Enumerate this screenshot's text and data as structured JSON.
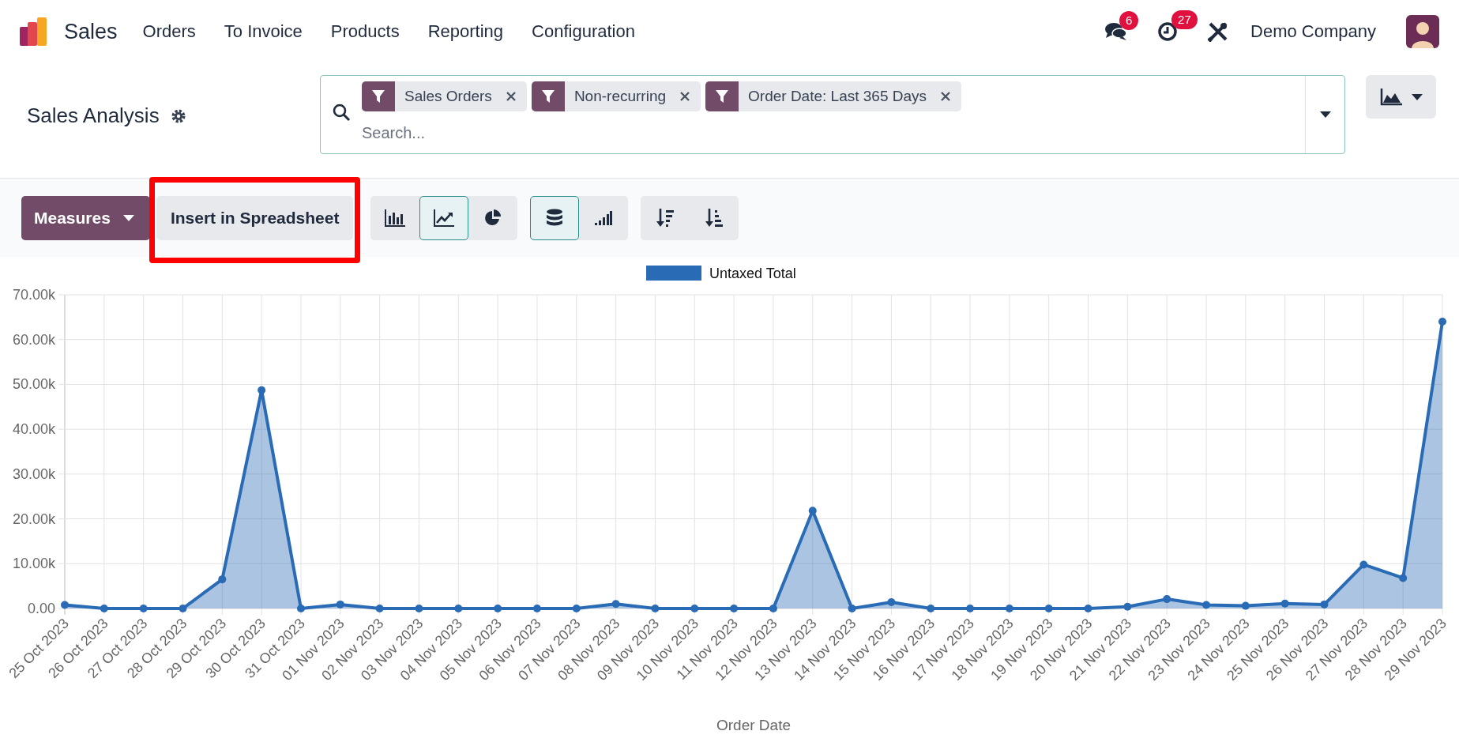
{
  "app": {
    "name": "Sales"
  },
  "menu": [
    {
      "label": "Orders"
    },
    {
      "label": "To Invoice"
    },
    {
      "label": "Products"
    },
    {
      "label": "Reporting"
    },
    {
      "label": "Configuration"
    }
  ],
  "systray": {
    "messages_count": "6",
    "activities_count": "27",
    "company": "Demo Company"
  },
  "breadcrumb": {
    "title": "Sales Analysis"
  },
  "search": {
    "facets": [
      {
        "label": "Sales Orders"
      },
      {
        "label": "Non-recurring"
      },
      {
        "label": "Order Date: Last 365 Days"
      }
    ],
    "placeholder": "Search..."
  },
  "toolbar": {
    "measures": "Measures",
    "insert": {
      "label": "Insert in Spreadsheet",
      "highlighted": true
    },
    "chart_types": [
      {
        "kind": "bar",
        "selected": false
      },
      {
        "kind": "line",
        "selected": true
      },
      {
        "kind": "pie",
        "selected": false
      }
    ],
    "options": [
      {
        "kind": "stacked",
        "selected": true
      },
      {
        "kind": "cumulative",
        "selected": false
      }
    ],
    "sort": [
      {
        "kind": "descending"
      },
      {
        "kind": "ascending"
      }
    ]
  },
  "chart_data": {
    "type": "area",
    "xlabel": "Order Date",
    "grid": true,
    "categories": [
      "25 Oct 2023",
      "26 Oct 2023",
      "27 Oct 2023",
      "28 Oct 2023",
      "29 Oct 2023",
      "30 Oct 2023",
      "31 Oct 2023",
      "01 Nov 2023",
      "02 Nov 2023",
      "03 Nov 2023",
      "04 Nov 2023",
      "05 Nov 2023",
      "06 Nov 2023",
      "07 Nov 2023",
      "08 Nov 2023",
      "09 Nov 2023",
      "10 Nov 2023",
      "11 Nov 2023",
      "12 Nov 2023",
      "13 Nov 2023",
      "14 Nov 2023",
      "15 Nov 2023",
      "16 Nov 2023",
      "17 Nov 2023",
      "18 Nov 2023",
      "19 Nov 2023",
      "20 Nov 2023",
      "21 Nov 2023",
      "22 Nov 2023",
      "23 Nov 2023",
      "24 Nov 2023",
      "25 Nov 2023",
      "26 Nov 2023",
      "27 Nov 2023",
      "28 Nov 2023",
      "29 Nov 2023"
    ],
    "series": [
      {
        "name": "Untaxed Total",
        "color": "#2a6bb6",
        "values": [
          800,
          0,
          0,
          0,
          6500,
          48700,
          0,
          900,
          0,
          0,
          0,
          0,
          0,
          0,
          1000,
          0,
          0,
          0,
          0,
          21800,
          0,
          1400,
          0,
          0,
          0,
          0,
          0,
          400,
          2100,
          800,
          600,
          1100,
          900,
          9800,
          6800,
          64000
        ]
      }
    ],
    "ylim": [
      0,
      70000
    ],
    "yticks": [
      {
        "value": 0,
        "label": "0.00"
      },
      {
        "value": 10000,
        "label": "10.00k"
      },
      {
        "value": 20000,
        "label": "20.00k"
      },
      {
        "value": 30000,
        "label": "30.00k"
      },
      {
        "value": 40000,
        "label": "40.00k"
      },
      {
        "value": 50000,
        "label": "50.00k"
      },
      {
        "value": 60000,
        "label": "60.00k"
      },
      {
        "value": 70000,
        "label": "70.00k"
      }
    ]
  }
}
